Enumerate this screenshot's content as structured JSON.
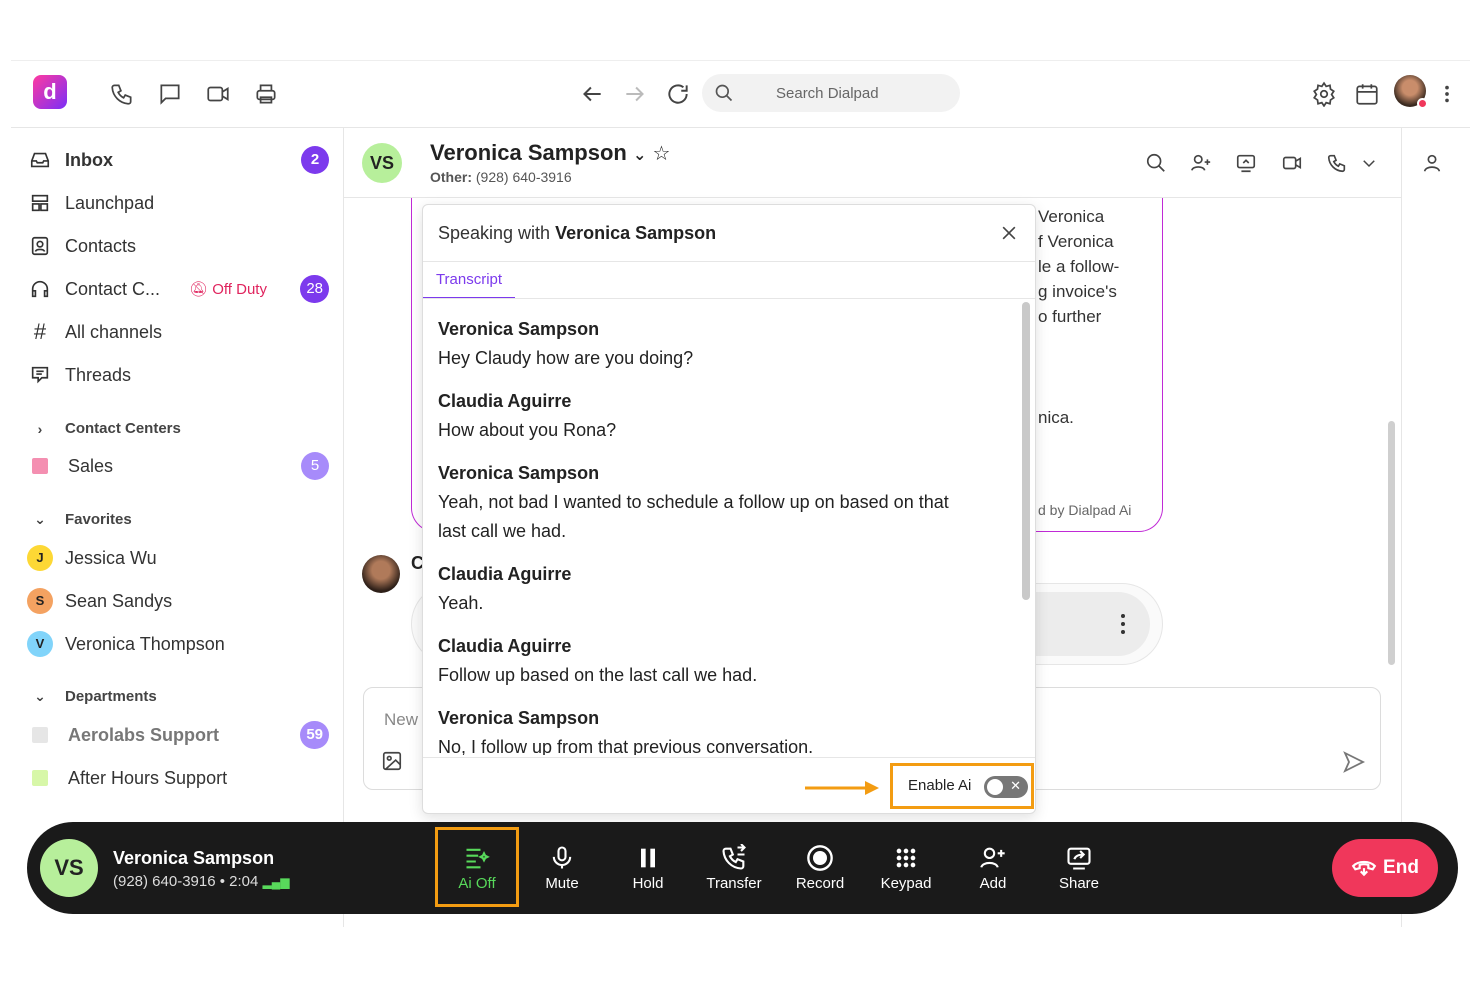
{
  "topbar": {
    "search_placeholder": "Search Dialpad",
    "logo_letter": "d"
  },
  "sidebar": {
    "inbox": {
      "label": "Inbox",
      "count": "2"
    },
    "launchpad": "Launchpad",
    "contacts": "Contacts",
    "contact_center": {
      "label": "Contact C...",
      "status": "Off Duty",
      "count": "28"
    },
    "all_channels": "All channels",
    "threads": "Threads",
    "contact_centers_section": "Contact Centers",
    "sales": {
      "label": "Sales",
      "count": "5",
      "color": "#f48fb1"
    },
    "favorites_section": "Favorites",
    "favorites": [
      {
        "initial": "J",
        "name": "Jessica Wu",
        "color": "#fdd835"
      },
      {
        "initial": "S",
        "name": "Sean Sandys",
        "color": "#f4a261"
      },
      {
        "initial": "V",
        "name": "Veronica Thompson",
        "color": "#81d4fa"
      }
    ],
    "departments_section": "Departments",
    "aerolabs": {
      "label": "Aerolabs Support",
      "count": "59"
    },
    "after_hours": "After Hours Support"
  },
  "header": {
    "initials": "VS",
    "name": "Veronica Sampson",
    "other_label": "Other:",
    "other_phone": "(928) 640-3916"
  },
  "chat": {
    "bubble_lines": [
      "Veronica",
      "f Veronica",
      "le a follow-",
      "g invoice's",
      "o further",
      "nica.",
      "d by Dialpad Ai"
    ],
    "sender_initial": "C",
    "composer_placeholder": "New"
  },
  "popup": {
    "title_prefix": "Speaking with",
    "title_name": "Veronica Sampson",
    "tab": "Transcript",
    "transcript": [
      {
        "speaker": "Veronica Sampson",
        "text": "Hey Claudy how are you doing?"
      },
      {
        "speaker": "Claudia Aguirre",
        "text": "How about you Rona?"
      },
      {
        "speaker": "Veronica Sampson",
        "text": "Yeah, not bad I wanted to schedule a follow up on based on that",
        "text2": "last call we had."
      },
      {
        "speaker": "Claudia Aguirre",
        "text": "Yeah."
      },
      {
        "speaker": "Claudia Aguirre",
        "text": "Follow up based on the last call we had."
      },
      {
        "speaker": "Veronica Sampson",
        "text": "No, I follow up from that previous conversation."
      }
    ],
    "enable_ai_label": "Enable Ai",
    "enable_ai_on": false
  },
  "callbar": {
    "initials": "VS",
    "name": "Veronica Sampson",
    "phone": "(928) 640-3916",
    "duration": "2:04",
    "buttons": {
      "ai": "Ai Off",
      "mute": "Mute",
      "hold": "Hold",
      "transfer": "Transfer",
      "record": "Record",
      "keypad": "Keypad",
      "add": "Add",
      "share": "Share"
    },
    "end": "End"
  },
  "colors": {
    "accent": "#7c3aed",
    "highlight": "#f39c12",
    "end": "#f0375b",
    "ai_green": "#58d95b"
  }
}
